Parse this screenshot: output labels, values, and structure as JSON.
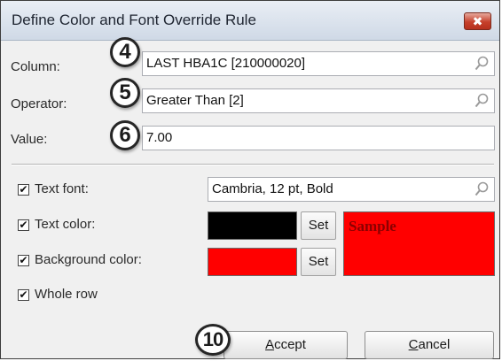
{
  "window": {
    "title": "Define Color and Font Override Rule",
    "close_glyph": "✖"
  },
  "form": {
    "column": {
      "label": "Column:",
      "value": "LAST HBA1C [210000020]"
    },
    "operator": {
      "label": "Operator:",
      "value": "Greater Than [2]"
    },
    "value": {
      "label": "Value:",
      "value": "7.00"
    }
  },
  "options": {
    "text_font": {
      "label": "Text font:",
      "checked": true,
      "value": "Cambria, 12 pt, Bold"
    },
    "text_color": {
      "label": "Text color:",
      "checked": true,
      "color": "#000000",
      "set_label": "Set"
    },
    "background_color": {
      "label": "Background color:",
      "checked": true,
      "color": "#ff0000",
      "set_label": "Set"
    },
    "whole_row": {
      "label": "Whole row",
      "checked": true
    }
  },
  "sample": {
    "text": "Sample",
    "text_color": "#8b0000",
    "background": "#ff0000"
  },
  "buttons": {
    "accept_mnemonic": "A",
    "accept_rest": "ccept",
    "cancel_mnemonic": "C",
    "cancel_rest": "ancel"
  },
  "callouts": {
    "column": "4",
    "operator": "5",
    "value": "6",
    "accept": "10"
  },
  "icons": {
    "lookup": "magnifier-icon",
    "check": "✔"
  }
}
